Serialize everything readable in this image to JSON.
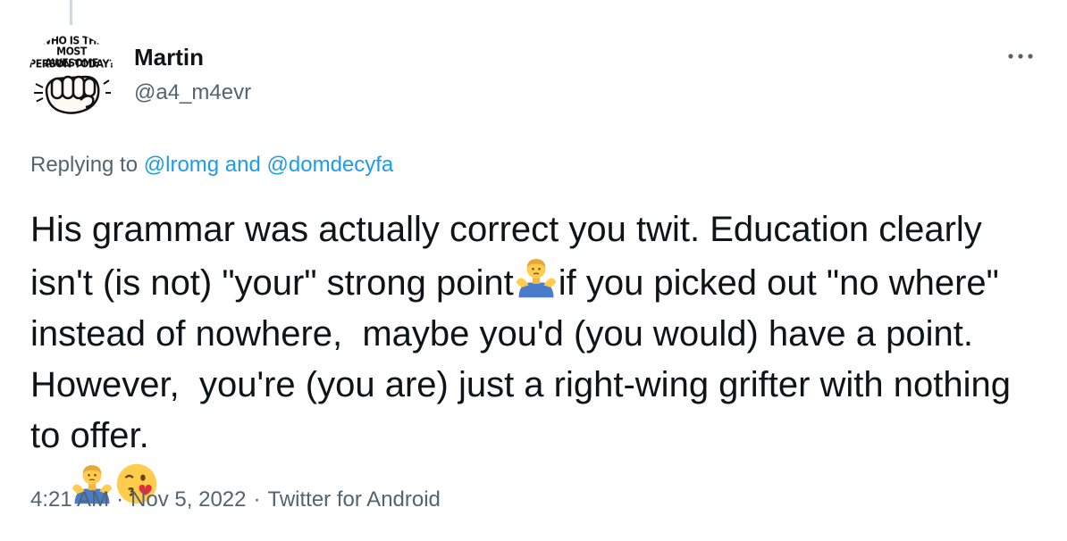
{
  "author": {
    "display_name": "Martin",
    "handle": "@a4_m4evr",
    "avatar_text": [
      "WHO IS THE",
      "MOST AWESOME",
      "PERSON TODAY?"
    ]
  },
  "more_icon": "more-horizontal-icon",
  "reply": {
    "prefix": "Replying to",
    "user1": "@lromg",
    "conjunction": "and",
    "user2": "@domdecyfa"
  },
  "body": {
    "part1": "His grammar was actually correct you twit. Education clearly isn't (is not) \"your\" strong point",
    "emoji1": "man-shrugging-emoji",
    "part2": "if you picked out \"no where\" instead of nowhere,  maybe you'd (you would) have a point.  However,  you're (you are) just a right-wing grifter with nothing to offer.",
    "emoji2": "man-shrugging-emoji",
    "emoji3": "face-blowing-kiss-emoji"
  },
  "meta": {
    "time": "4:21 AM",
    "date": "Nov 5, 2022",
    "source": "Twitter for Android",
    "separator": "·"
  },
  "colors": {
    "text": "#0f1419",
    "secondary": "#536471",
    "link": "#1d9bf0"
  }
}
